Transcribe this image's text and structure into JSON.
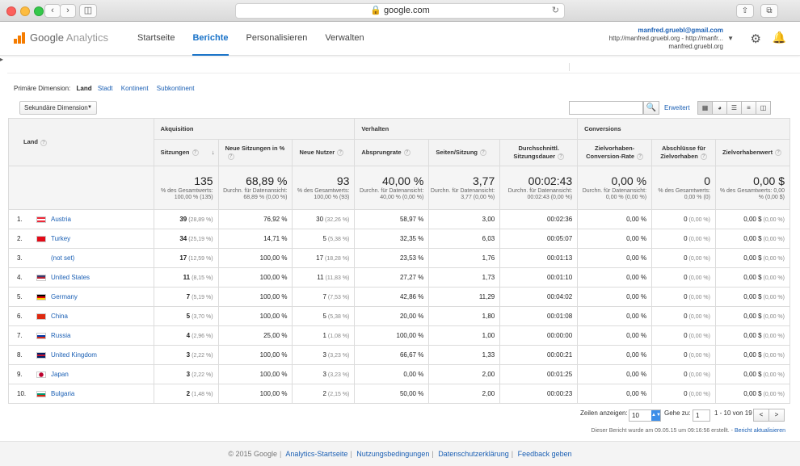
{
  "browser": {
    "url": "google.com"
  },
  "app": {
    "logo_google": "Google",
    "logo_analytics": "Analytics"
  },
  "nav": [
    {
      "label": "Startseite",
      "active": false
    },
    {
      "label": "Berichte",
      "active": true
    },
    {
      "label": "Personalisieren",
      "active": false
    },
    {
      "label": "Verwalten",
      "active": false
    }
  ],
  "account": {
    "email": "manfred.gruebl@gmail.com",
    "property": "http://manfred.gruebl.org - http://manfr...",
    "view": "manfred.gruebl.org"
  },
  "dimension": {
    "label": "Primäre Dimension:",
    "active": "Land",
    "options": [
      "Stadt",
      "Kontinent",
      "Subkontinent"
    ]
  },
  "secondary_dimension": "Sekundäre Dimension",
  "search": {
    "placeholder": "",
    "advanced": "Erweitert"
  },
  "table": {
    "groups": [
      "Akquisition",
      "Verhalten",
      "Conversions"
    ],
    "land_header": "Land",
    "metrics": [
      "Sitzungen",
      "Neue Sitzungen in %",
      "Neue Nutzer",
      "Absprungrate",
      "Seiten/Sitzung",
      "Durchschnittl. Sitzungsdauer",
      "Zielvorhaben-Conversion-Rate",
      "Abschlüsse für Zielvorhaben",
      "Zielvorhabenwert"
    ],
    "totals": [
      {
        "big": "135",
        "sm": "% des Gesamtwerts: 100,00 % (135)"
      },
      {
        "big": "68,89 %",
        "sm": "Durchn. für Datenansicht: 68,89 % (0,00 %)"
      },
      {
        "big": "93",
        "sm": "% des Gesamtwerts: 100,00 % (93)"
      },
      {
        "big": "40,00 %",
        "sm": "Durchn. für Datenansicht: 40,00 % (0,00 %)"
      },
      {
        "big": "3,77",
        "sm": "Durchn. für Datenansicht: 3,77 (0,00 %)"
      },
      {
        "big": "00:02:43",
        "sm": "Durchn. für Datenansicht: 00:02:43 (0,00 %)"
      },
      {
        "big": "0,00 %",
        "sm": "Durchn. für Datenansicht: 0,00 % (0,00 %)"
      },
      {
        "big": "0",
        "sm": "% des Gesamtwerts: 0,00 % (0)"
      },
      {
        "big": "0,00 $",
        "sm": "% des Gesamtwerts: 0,00 % (0,00 $)"
      }
    ],
    "rows": [
      {
        "num": "1.",
        "land": "Austria",
        "flag": [
          "#ed2939",
          "#fff",
          "#ed2939"
        ],
        "sessions": "39",
        "sessions_pct": "(28,89 %)",
        "new_pct": "76,92 %",
        "new_users": "30",
        "new_users_pct": "(32,26 %)",
        "bounce": "58,97 %",
        "pages": "3,00",
        "duration": "00:02:36",
        "conv": "0,00 %",
        "goals": "0",
        "goals_pct": "(0,00 %)",
        "value": "0,00 $",
        "value_pct": "(0,00 %)"
      },
      {
        "num": "2.",
        "land": "Turkey",
        "flag": [
          "#e30a17",
          "#e30a17",
          "#e30a17"
        ],
        "sessions": "34",
        "sessions_pct": "(25,19 %)",
        "new_pct": "14,71 %",
        "new_users": "5",
        "new_users_pct": "(5,38 %)",
        "bounce": "32,35 %",
        "pages": "6,03",
        "duration": "00:05:07",
        "conv": "0,00 %",
        "goals": "0",
        "goals_pct": "(0,00 %)",
        "value": "0,00 $",
        "value_pct": "(0,00 %)"
      },
      {
        "num": "3.",
        "land": "(not set)",
        "flag": [],
        "sessions": "17",
        "sessions_pct": "(12,59 %)",
        "new_pct": "100,00 %",
        "new_users": "17",
        "new_users_pct": "(18,28 %)",
        "bounce": "23,53 %",
        "pages": "1,76",
        "duration": "00:01:13",
        "conv": "0,00 %",
        "goals": "0",
        "goals_pct": "(0,00 %)",
        "value": "0,00 $",
        "value_pct": "(0,00 %)"
      },
      {
        "num": "4.",
        "land": "United States",
        "flag": [
          "#3c3b6e",
          "#b22234",
          "#fff"
        ],
        "sessions": "11",
        "sessions_pct": "(8,15 %)",
        "new_pct": "100,00 %",
        "new_users": "11",
        "new_users_pct": "(11,83 %)",
        "bounce": "27,27 %",
        "pages": "1,73",
        "duration": "00:01:10",
        "conv": "0,00 %",
        "goals": "0",
        "goals_pct": "(0,00 %)",
        "value": "0,00 $",
        "value_pct": "(0,00 %)"
      },
      {
        "num": "5.",
        "land": "Germany",
        "flag": [
          "#000",
          "#dd0000",
          "#ffce00"
        ],
        "sessions": "7",
        "sessions_pct": "(5,19 %)",
        "new_pct": "100,00 %",
        "new_users": "7",
        "new_users_pct": "(7,53 %)",
        "bounce": "42,86 %",
        "pages": "11,29",
        "duration": "00:04:02",
        "conv": "0,00 %",
        "goals": "0",
        "goals_pct": "(0,00 %)",
        "value": "0,00 $",
        "value_pct": "(0,00 %)"
      },
      {
        "num": "6.",
        "land": "China",
        "flag": [
          "#de2910",
          "#de2910",
          "#de2910"
        ],
        "sessions": "5",
        "sessions_pct": "(3,70 %)",
        "new_pct": "100,00 %",
        "new_users": "5",
        "new_users_pct": "(5,38 %)",
        "bounce": "20,00 %",
        "pages": "1,80",
        "duration": "00:01:08",
        "conv": "0,00 %",
        "goals": "0",
        "goals_pct": "(0,00 %)",
        "value": "0,00 $",
        "value_pct": "(0,00 %)"
      },
      {
        "num": "7.",
        "land": "Russia",
        "flag": [
          "#fff",
          "#0039a6",
          "#d52b1e"
        ],
        "sessions": "4",
        "sessions_pct": "(2,96 %)",
        "new_pct": "25,00 %",
        "new_users": "1",
        "new_users_pct": "(1,08 %)",
        "bounce": "100,00 %",
        "pages": "1,00",
        "duration": "00:00:00",
        "conv": "0,00 %",
        "goals": "0",
        "goals_pct": "(0,00 %)",
        "value": "0,00 $",
        "value_pct": "(0,00 %)"
      },
      {
        "num": "8.",
        "land": "United Kingdom",
        "flag": [
          "#012169",
          "#c8102e",
          "#012169"
        ],
        "sessions": "3",
        "sessions_pct": "(2,22 %)",
        "new_pct": "100,00 %",
        "new_users": "3",
        "new_users_pct": "(3,23 %)",
        "bounce": "66,67 %",
        "pages": "1,33",
        "duration": "00:00:21",
        "conv": "0,00 %",
        "goals": "0",
        "goals_pct": "(0,00 %)",
        "value": "0,00 $",
        "value_pct": "(0,00 %)"
      },
      {
        "num": "9.",
        "land": "Japan",
        "flag": [
          "#fff",
          "#fff",
          "#fff"
        ],
        "sessions": "3",
        "sessions_pct": "(2,22 %)",
        "new_pct": "100,00 %",
        "new_users": "3",
        "new_users_pct": "(3,23 %)",
        "bounce": "0,00 %",
        "pages": "2,00",
        "duration": "00:01:25",
        "conv": "0,00 %",
        "goals": "0",
        "goals_pct": "(0,00 %)",
        "value": "0,00 $",
        "value_pct": "(0,00 %)"
      },
      {
        "num": "10.",
        "land": "Bulgaria",
        "flag": [
          "#fff",
          "#00966e",
          "#d62612"
        ],
        "sessions": "2",
        "sessions_pct": "(1,48 %)",
        "new_pct": "100,00 %",
        "new_users": "2",
        "new_users_pct": "(2,15 %)",
        "bounce": "50,00 %",
        "pages": "2,00",
        "duration": "00:00:23",
        "conv": "0,00 %",
        "goals": "0",
        "goals_pct": "(0,00 %)",
        "value": "0,00 $",
        "value_pct": "(0,00 %)"
      }
    ]
  },
  "pager": {
    "rows_label": "Zeilen anzeigen:",
    "rows_value": "10",
    "goto_label": "Gehe zu:",
    "goto_value": "1",
    "range": "1 - 10 von 19",
    "prev": "<",
    "next": ">"
  },
  "created": {
    "text": "Dieser Bericht wurde am 09.05.15 um 09:16:56 erstellt. -",
    "link": "Bericht aktualisieren"
  },
  "footer": {
    "copyright": "© 2015 Google",
    "links": [
      "Analytics-Startseite",
      "Nutzungsbedingungen",
      "Datenschutzerklärung",
      "Feedback geben"
    ]
  }
}
